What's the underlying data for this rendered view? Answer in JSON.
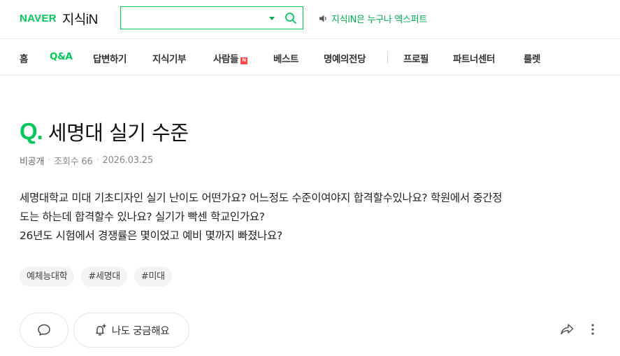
{
  "header": {
    "logo_brand": "NAVER",
    "logo_service": "지식iN",
    "search": {
      "value": "",
      "placeholder": ""
    },
    "promo_text": "지식iN은 누구나 엑스퍼트"
  },
  "nav": {
    "items": [
      {
        "label": "홈"
      },
      {
        "label": "Q&A",
        "active": true
      },
      {
        "label": "답변하기"
      },
      {
        "label": "지식기부"
      },
      {
        "label": "사람들",
        "badge": "N"
      },
      {
        "label": "베스트"
      },
      {
        "label": "명예의전당"
      },
      {
        "label": "프로필"
      },
      {
        "label": "파트너센터"
      },
      {
        "label": "룰렛"
      }
    ]
  },
  "question": {
    "mark": "Q.",
    "title": "세명대 실기 수준",
    "author": "비공개",
    "views": "조회수 66",
    "date": "2026.03.25",
    "body_lines": [
      "세명대학교 미대 기초디자인 실기 난이도 어떤가요? 어느정도 수준이여야지 합격할수있나요? 학원에서 중간정",
      "도는 하는데 합격할수 있나요? 실기가 빡센 학교인가요?",
      "26년도 시험에서 경쟁률은 몇이었고 예비 몇까지 빠졌나요?"
    ],
    "tags": [
      "예체능대학",
      "#세명대",
      "#미대"
    ]
  },
  "actions": {
    "curious_label": "나도 궁금해요"
  },
  "colors": {
    "accent": "#03c75a",
    "badge": "#ff4a4a"
  },
  "icons": [
    "dropdown-icon",
    "search-icon",
    "speaker-icon",
    "comment-icon",
    "bell-plus-icon",
    "share-icon",
    "more-icon"
  ]
}
